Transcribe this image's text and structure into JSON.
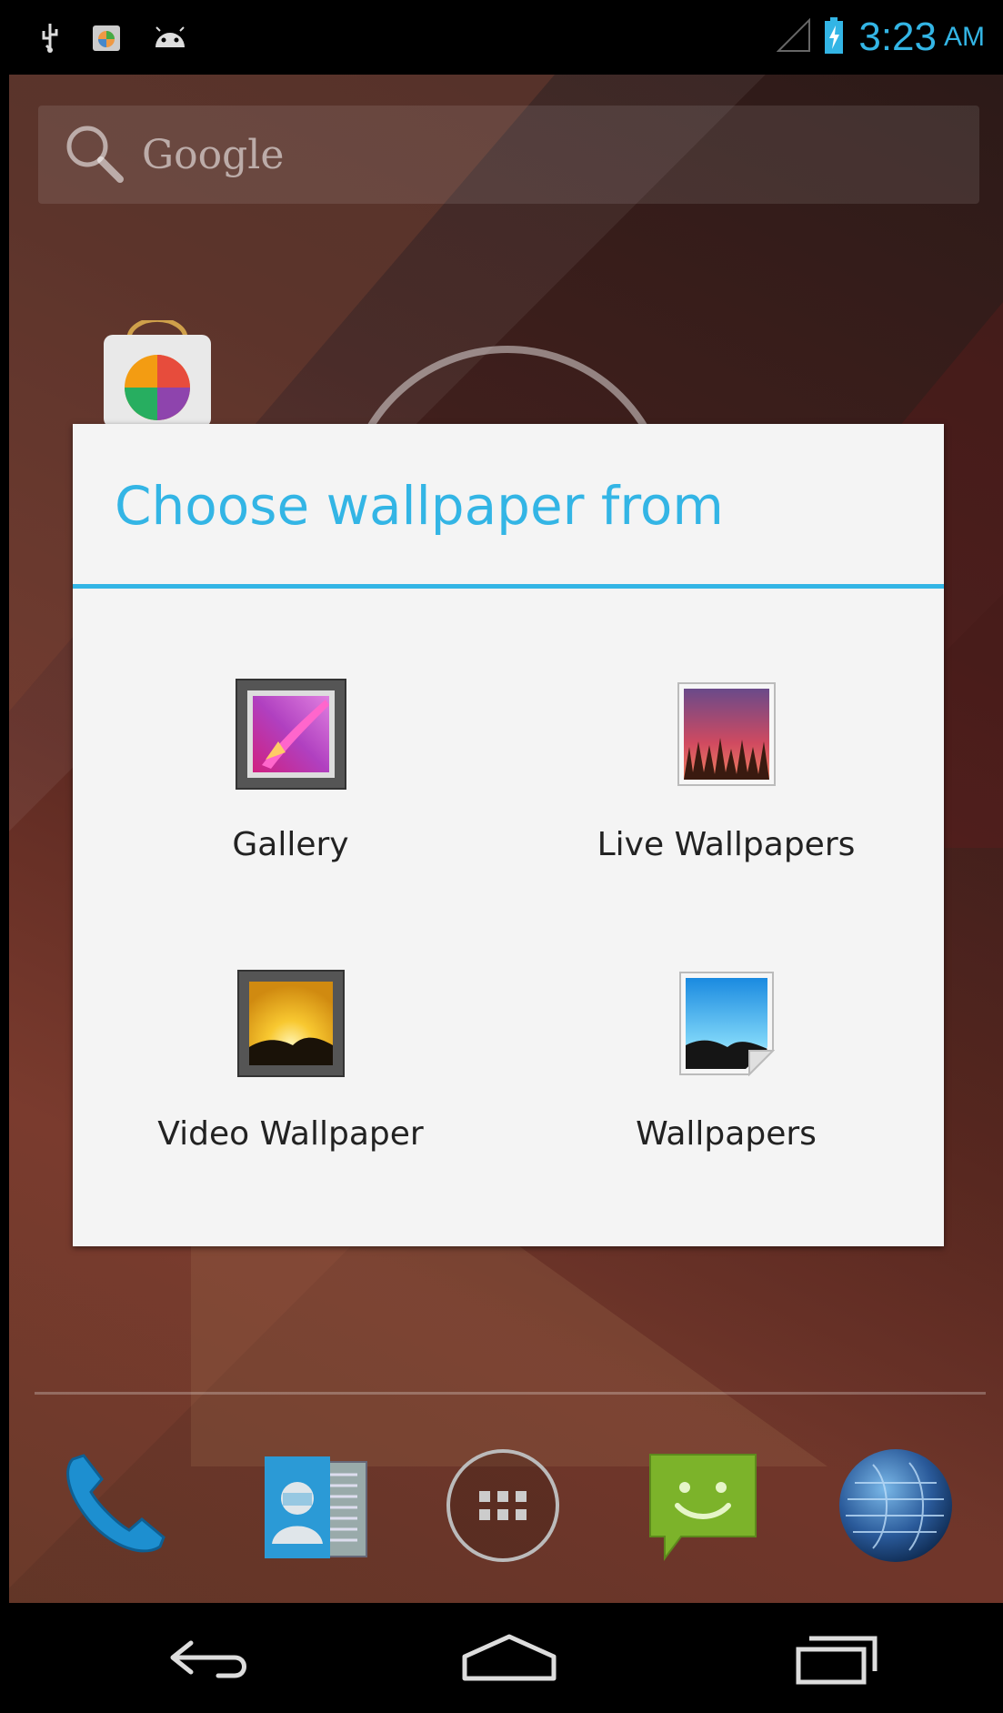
{
  "status_bar": {
    "time": "3:23",
    "ampm": "AM",
    "icons": [
      "usb-icon",
      "play-store-notification-icon",
      "android-debug-icon",
      "signal-icon",
      "battery-charging-icon"
    ]
  },
  "search": {
    "label": "Google",
    "icon": "search-icon"
  },
  "dialog": {
    "title": "Choose wallpaper from",
    "options": [
      {
        "label": "Gallery",
        "icon": "gallery-icon"
      },
      {
        "label": "Live Wallpapers",
        "icon": "live-wallpapers-icon"
      },
      {
        "label": "Video Wallpaper",
        "icon": "video-wallpaper-icon"
      },
      {
        "label": "Wallpapers",
        "icon": "wallpapers-icon"
      }
    ]
  },
  "dock": [
    "phone-icon",
    "contacts-icon",
    "app-drawer-icon",
    "messaging-icon",
    "browser-icon"
  ],
  "nav": [
    "back-icon",
    "home-icon",
    "recents-icon"
  ],
  "colors": {
    "accent": "#33b5e5",
    "dialog_bg": "#f4f4f4"
  }
}
